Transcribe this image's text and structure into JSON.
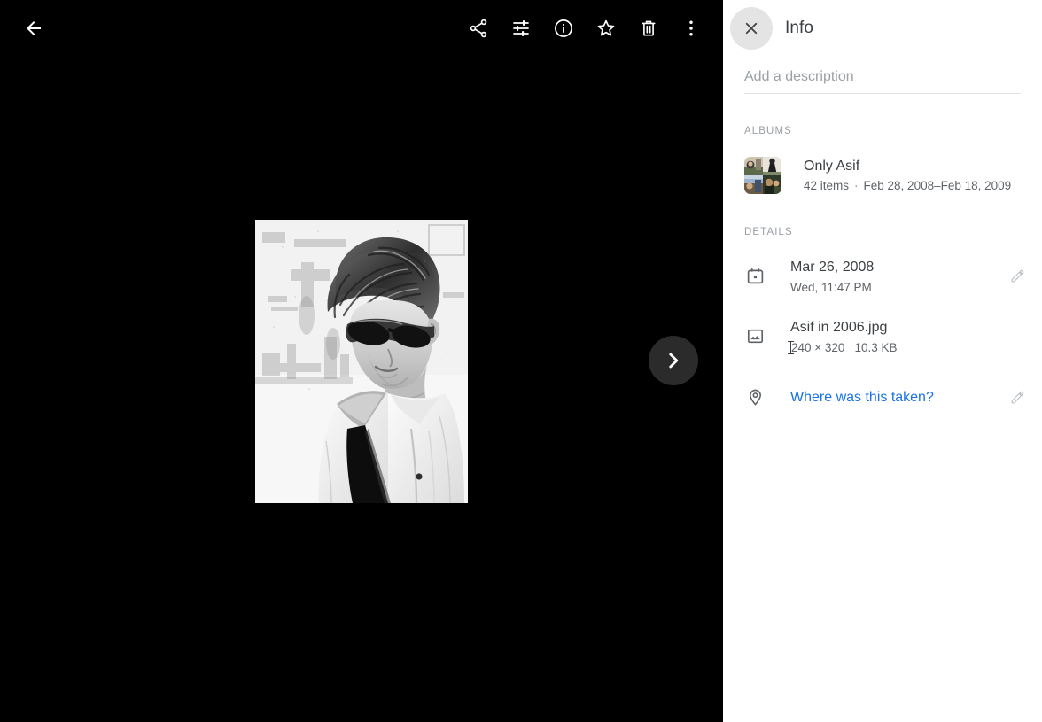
{
  "viewer": {
    "back_label": "Back",
    "next_label": "Next photo",
    "toolbar": [
      {
        "name": "share-icon",
        "label": "Share"
      },
      {
        "name": "tune-icon",
        "label": "Edit"
      },
      {
        "name": "info-icon",
        "label": "Info"
      },
      {
        "name": "star-icon",
        "label": "Favorite"
      },
      {
        "name": "trash-icon",
        "label": "Delete"
      },
      {
        "name": "more-vert-icon",
        "label": "More options"
      }
    ],
    "background_color": "#000000",
    "photo_alt": "Asif in 2006.jpg"
  },
  "panel": {
    "title": "Info",
    "close_label": "Close",
    "description": {
      "placeholder": "Add a description",
      "value": ""
    },
    "albums_section_label": "ALBUMS",
    "albums": [
      {
        "title": "Only Asif",
        "item_count": "42 items",
        "separator": "·",
        "date_range": "Feb 28, 2008–Feb 18, 2009"
      }
    ],
    "details_section_label": "DETAILS",
    "details": [
      {
        "icon": "calendar-icon",
        "primary": "Mar 26, 2008",
        "secondary": "Wed, 11:47 PM",
        "editable": true
      },
      {
        "icon": "image-icon",
        "primary": "Asif in 2006.jpg",
        "dimensions": "240 × 320",
        "file_size": "10.3 KB",
        "editable": false
      }
    ],
    "location": {
      "icon": "location-pin-icon",
      "label": "Where was this taken?",
      "link_color": "#1a73e8",
      "editable": true
    }
  }
}
